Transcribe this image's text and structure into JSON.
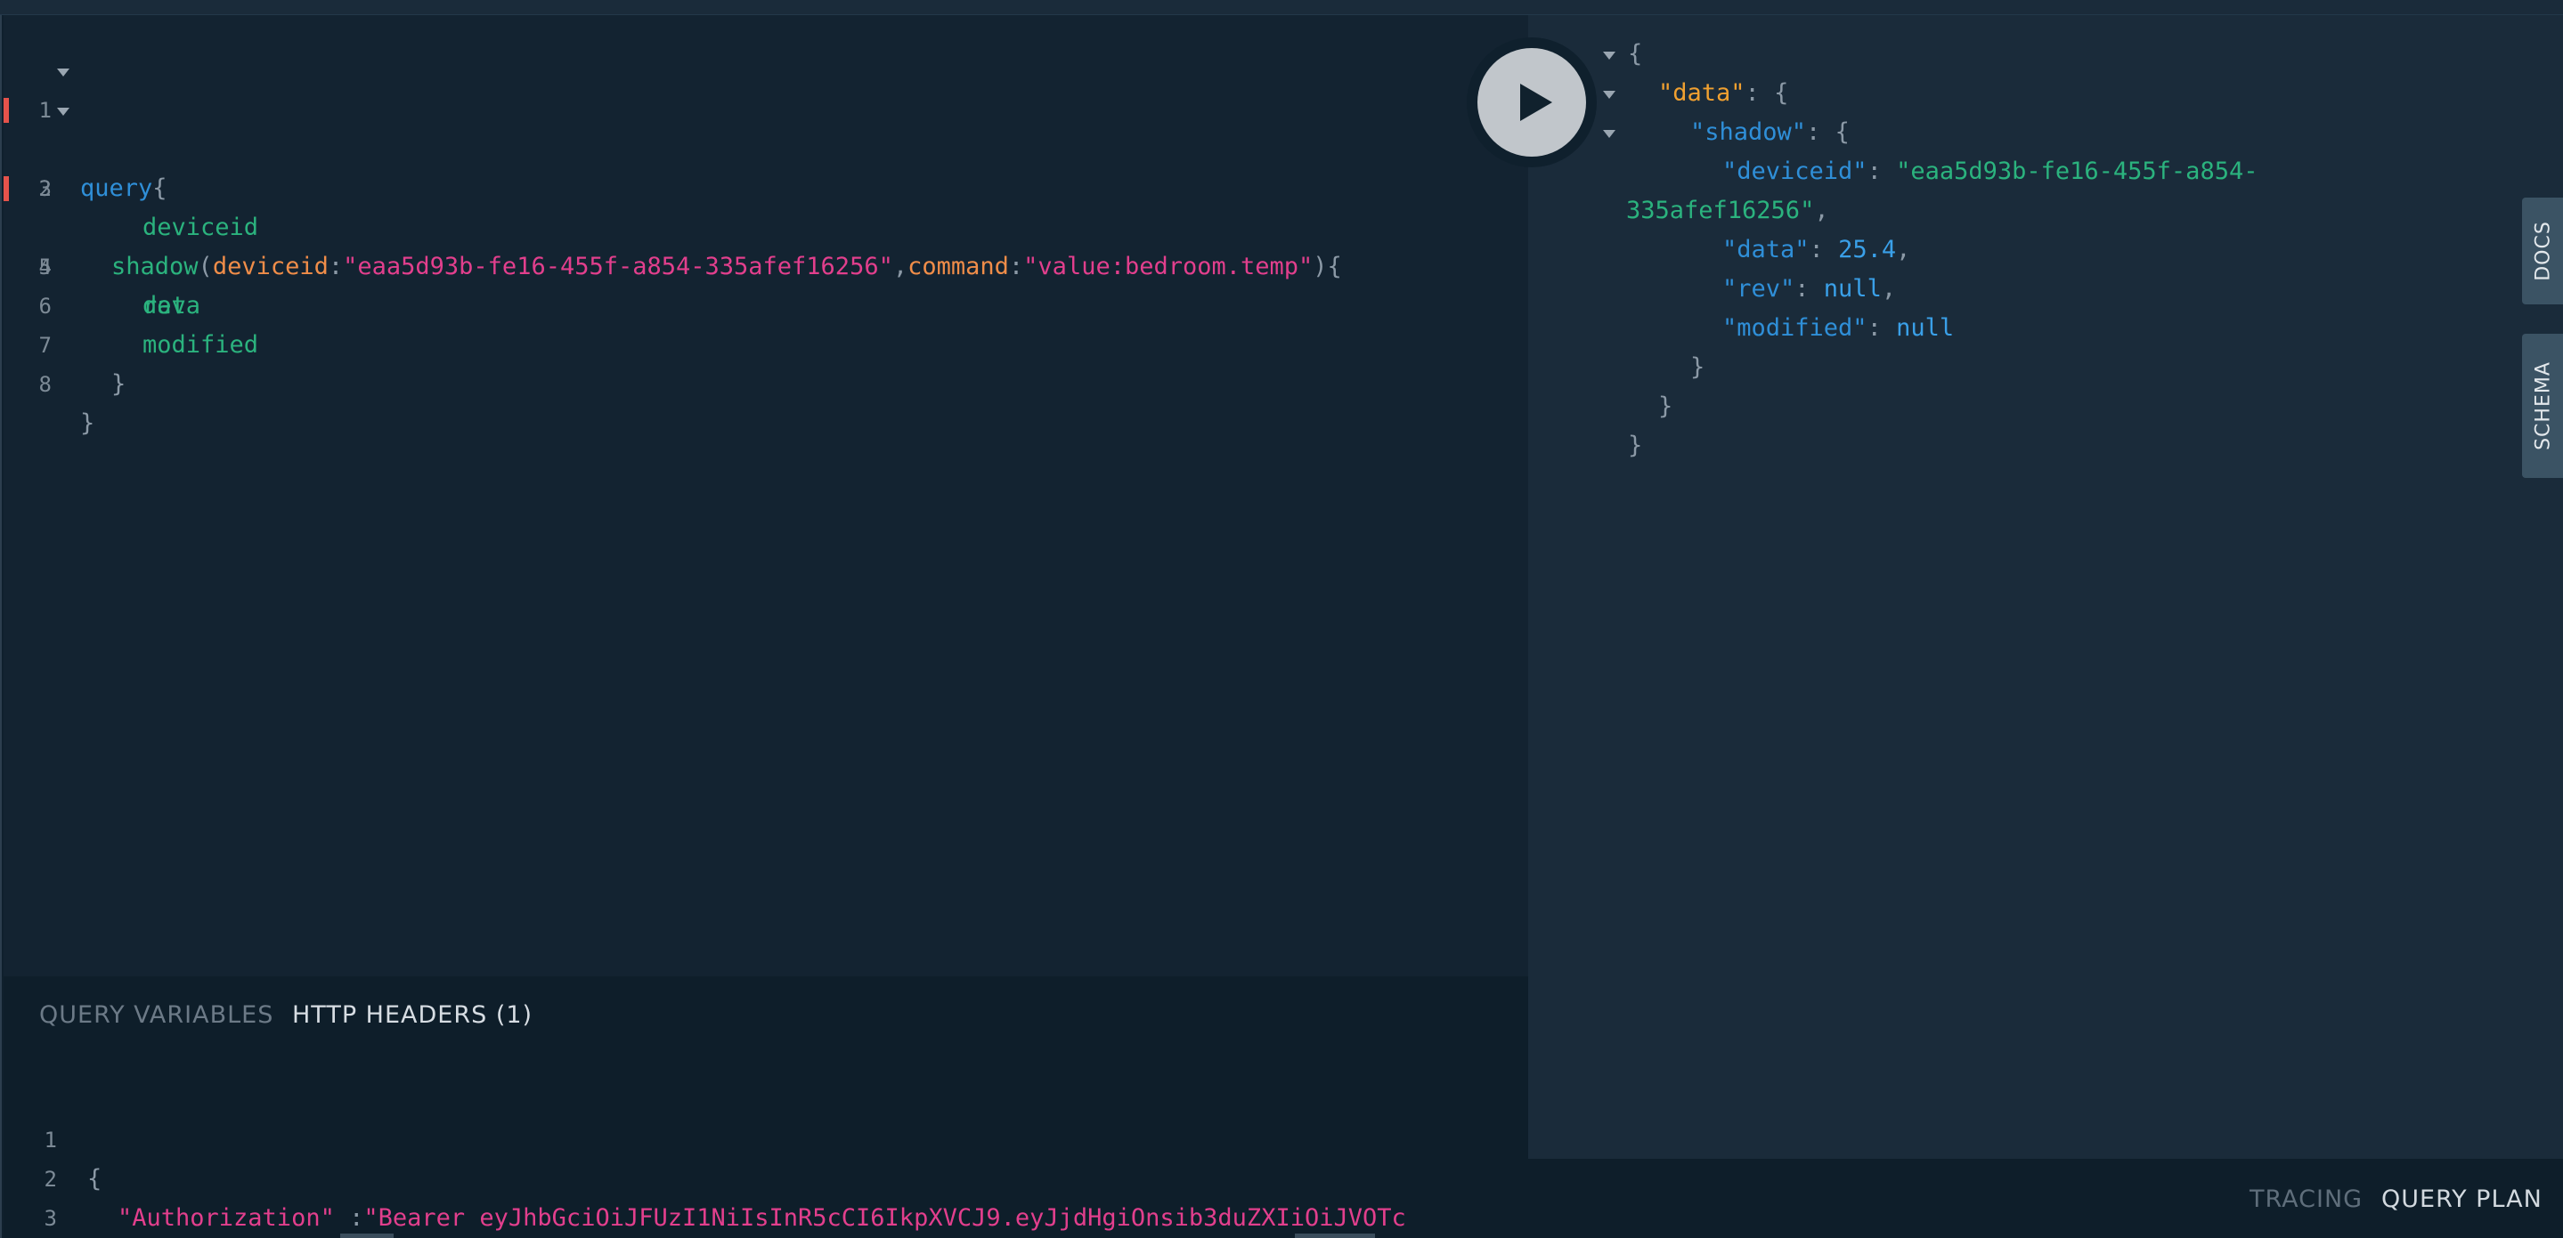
{
  "editor": {
    "lines": [
      {
        "num": "1",
        "tokens": {
          "kw": "query",
          "brace": "{"
        }
      },
      {
        "num": "2",
        "tokens": {
          "fn": "shadow",
          "open": "(",
          "arg1": "deviceid",
          "colon1": ":",
          "str1": "\"eaa5d93b-fe16-455f-a854-335afef16256\"",
          "comma": ",",
          "arg2": "command",
          "colon2": ":",
          "str2": "\"value:bedroom.temp\"",
          "close": ")",
          "brace": "{"
        }
      },
      {
        "num": "3",
        "field": "deviceid"
      },
      {
        "num": "4",
        "field": "data"
      },
      {
        "num": "5",
        "field": "rev"
      },
      {
        "num": "6",
        "field": "modified"
      },
      {
        "num": "7",
        "brace": "}"
      },
      {
        "num": "8",
        "brace": "}"
      }
    ]
  },
  "run_button": {
    "icon": "play-icon"
  },
  "vars_pane": {
    "tabs": [
      "QUERY VARIABLES",
      "HTTP HEADERS (1)"
    ],
    "lines": [
      {
        "num": "1",
        "brace": "{"
      },
      {
        "num": "2",
        "key": "\"Authorization\"",
        "sep": " :",
        "value": "\"Bearer eyJhbGciOiJFUzI1NiIsInR5cCI6IkpXVCJ9.eyJjdHgiOnsib3duZXIiOiJVOTc"
      },
      {
        "num": "3",
        "brace": "}"
      }
    ]
  },
  "result": {
    "open": "{",
    "data_key": "\"data\"",
    "shadow_key": "\"shadow\"",
    "deviceid_key": "\"deviceid\"",
    "deviceid_val_1": "\"eaa5d93b-fe16-455f-a854-",
    "deviceid_val_2": "335afef16256\"",
    "data_field_key": "\"data\"",
    "data_field_val": "25.4",
    "rev_key": "\"rev\"",
    "rev_val": "null",
    "modified_key": "\"modified\"",
    "modified_val": "null",
    "colon": ": ",
    "comma": ",",
    "brace_open": "{",
    "brace_close": "}"
  },
  "side_tabs": [
    "DOCS",
    "SCHEMA"
  ],
  "footer_tabs": [
    "TRACING",
    "QUERY PLAN"
  ],
  "colors": {
    "background": "#132331",
    "keyword": "#2f8fd8",
    "field": "#2bb37e",
    "argument": "#f08d49",
    "string": "#e23f8d",
    "error_marker": "#e5534b"
  }
}
